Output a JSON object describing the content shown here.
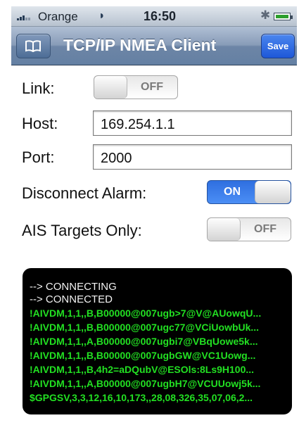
{
  "status_bar": {
    "carrier": "Orange",
    "time": "16:50",
    "icons": [
      "signal-bars-icon",
      "wifi-icon",
      "bluetooth-icon",
      "battery-icon"
    ]
  },
  "nav": {
    "title": "TCP/IP NMEA Client",
    "left_icon": "book-icon",
    "save_label": "Save"
  },
  "settings": {
    "link_label": "Link:",
    "link_state": "OFF",
    "host_label": "Host:",
    "host_value": "169.254.1.1",
    "port_label": "Port:",
    "port_value": "2000",
    "alarm_label": "Disconnect Alarm:",
    "alarm_state": "ON",
    "ais_label": "AIS Targets Only:",
    "ais_state": "OFF"
  },
  "console": {
    "lines": [
      "--> CONNECTING",
      "--> CONNECTED",
      "!AIVDM,1,1,,B,B00000@007ugb>7@V@AUowqU...",
      "!AIVDM,1,1,,B,B00000@007ugc77@VCiUowbUk...",
      "!AIVDM,1,1,,A,B00000@007ugbi7@VBqUowe5k...",
      "!AIVDM,1,1,,B,B00000@007ugbGW@VC1Uowg...",
      "!AIVDM,1,1,,B,4h2=aDQubV@ESOls:8Ls9H100...",
      "!AIVDM,1,1,,A,B00000@007ugbH7@VCUUowj5k...",
      "$GPGSV,3,3,12,16,10,173,,28,08,326,35,07,06,2..."
    ]
  },
  "colors": {
    "nav_blue": "#6d85a6",
    "save_blue": "#1e58d8",
    "toggle_on_blue": "#2f6fe0",
    "console_green": "#22e022"
  }
}
